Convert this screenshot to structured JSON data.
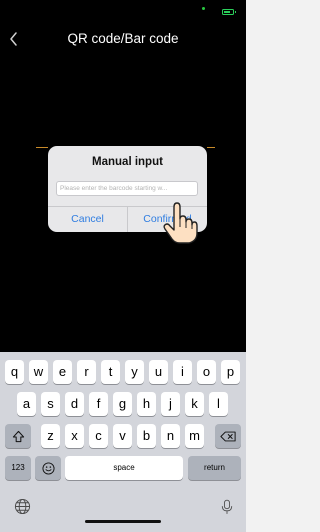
{
  "header": {
    "title": "QR code/Bar code"
  },
  "dialog": {
    "title": "Manual input",
    "placeholder": "Please enter the barcode starting w...",
    "cancel_label": "Cancel",
    "confirm_label": "Confirmed"
  },
  "keyboard": {
    "row1": [
      "q",
      "w",
      "e",
      "r",
      "t",
      "y",
      "u",
      "i",
      "o",
      "p"
    ],
    "row2": [
      "a",
      "s",
      "d",
      "f",
      "g",
      "h",
      "j",
      "k",
      "l"
    ],
    "row3": [
      "z",
      "x",
      "c",
      "v",
      "b",
      "n",
      "m"
    ],
    "numbers_label": "123",
    "space_label": "space",
    "return_label": "return"
  },
  "colors": {
    "accent": "#2f7de1",
    "status_green": "#2bd05b",
    "scan_line": "#c98b2a",
    "keyboard_bg": "#d3d5db"
  }
}
